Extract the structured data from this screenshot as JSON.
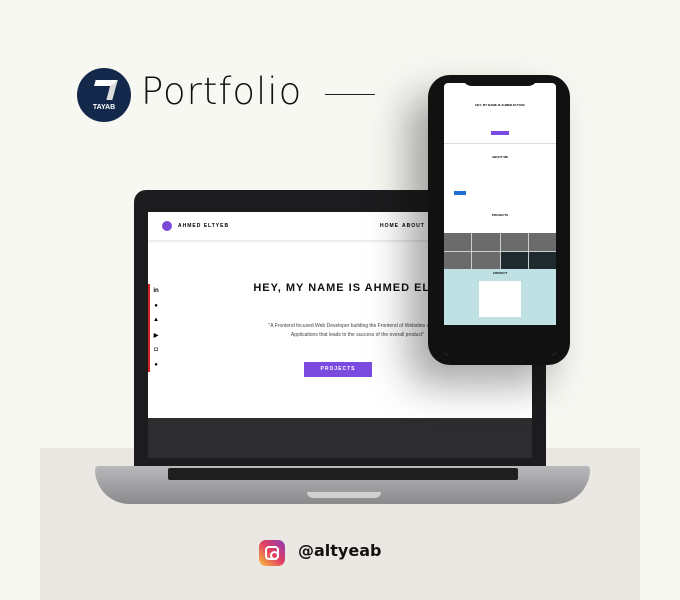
{
  "header": {
    "logo_text": "TAYAB",
    "title": "Portfolio"
  },
  "site": {
    "brand": "AHMED ELTYEB",
    "nav": [
      "HOME",
      "ABOUT"
    ],
    "hero_title": "HEY, MY NAME IS AHMED ELTYEB",
    "hero_quote": "\"A Frontend focused Web Developer building the Frontend of Websites and Web Applications that leads to the success of the overall product\"",
    "cta": "PROJECTS",
    "social": [
      "in",
      "gh",
      "tw",
      "yt",
      "ig",
      "fb"
    ]
  },
  "phone": {
    "hero_title": "HEY, MY NAME IS AHMED ELTYEB",
    "about": "ABOUT ME",
    "projects": "PROJECTS",
    "contact": "CONTACT"
  },
  "footer": {
    "handle": "@altyeab"
  },
  "colors": {
    "accent": "#7b4be0",
    "logo_bg": "#13284a"
  }
}
